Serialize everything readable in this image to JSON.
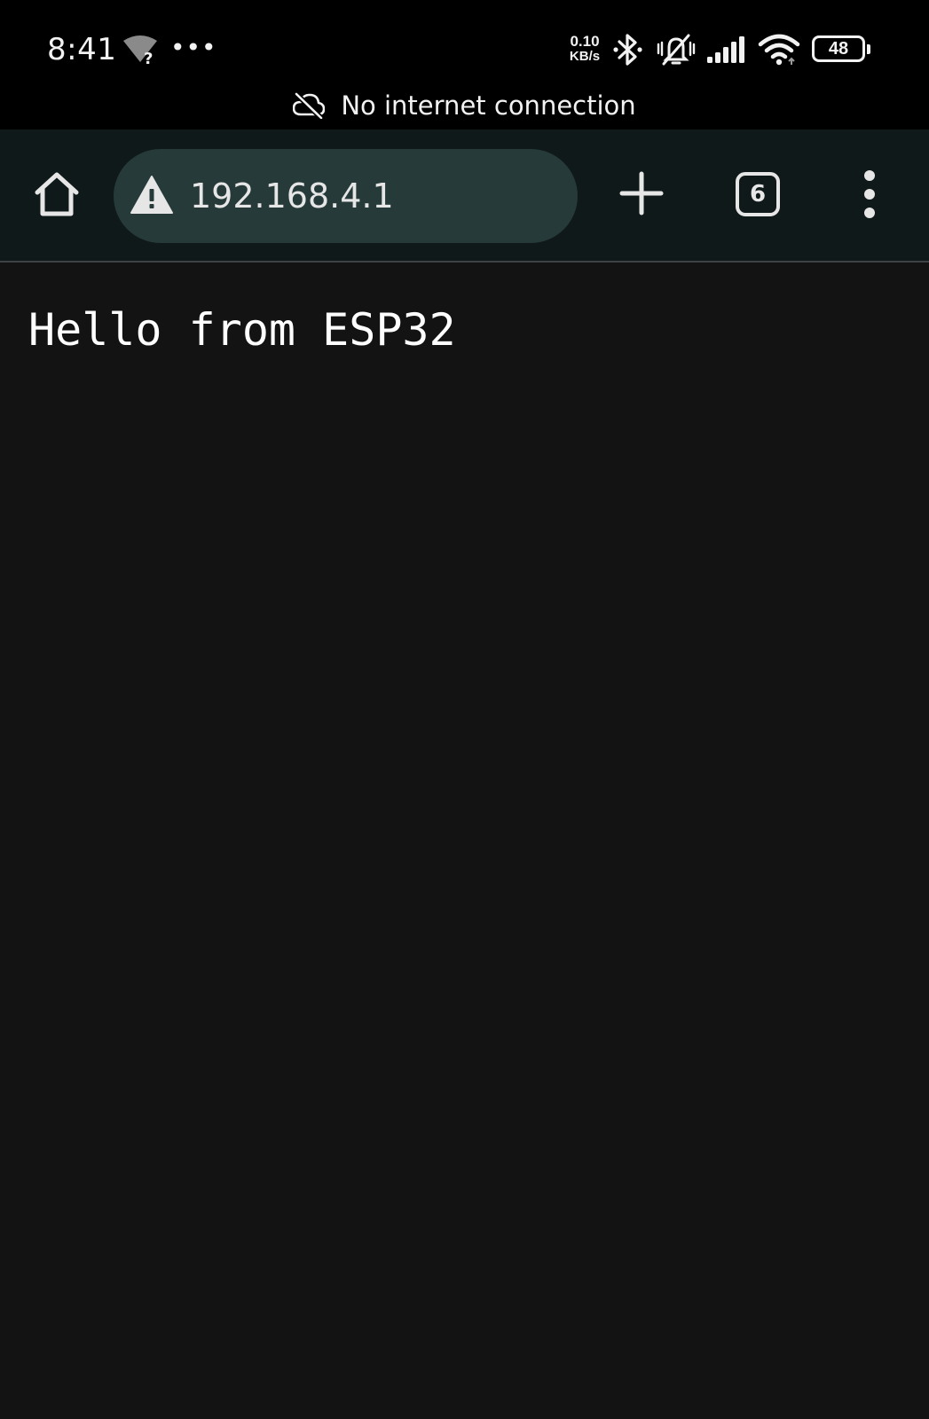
{
  "status_bar": {
    "time": "8:41",
    "more_indicator": "•••",
    "net_speed_value": "0.10",
    "net_speed_unit": "KB/s",
    "battery_level": "48",
    "icons": [
      "wifi-unknown-icon",
      "bluetooth-icon",
      "silent-vibrate-icon",
      "signal-bars-icon",
      "wifi-icon",
      "battery-icon"
    ]
  },
  "offline_banner": {
    "icon": "cloud-off-icon",
    "text": "No internet connection"
  },
  "toolbar": {
    "home_icon": "home-icon",
    "security_icon": "warning-icon",
    "url": "192.168.4.1",
    "new_tab_icon": "plus-icon",
    "tab_count": "6",
    "menu_icon": "more-vert-icon"
  },
  "page": {
    "text": "Hello from ESP32"
  },
  "colors": {
    "status_bar_bg": "#000000",
    "toolbar_bg": "#10191a",
    "omnibox_bg": "#263a3a",
    "page_bg": "#131313",
    "text": "#ffffff"
  }
}
